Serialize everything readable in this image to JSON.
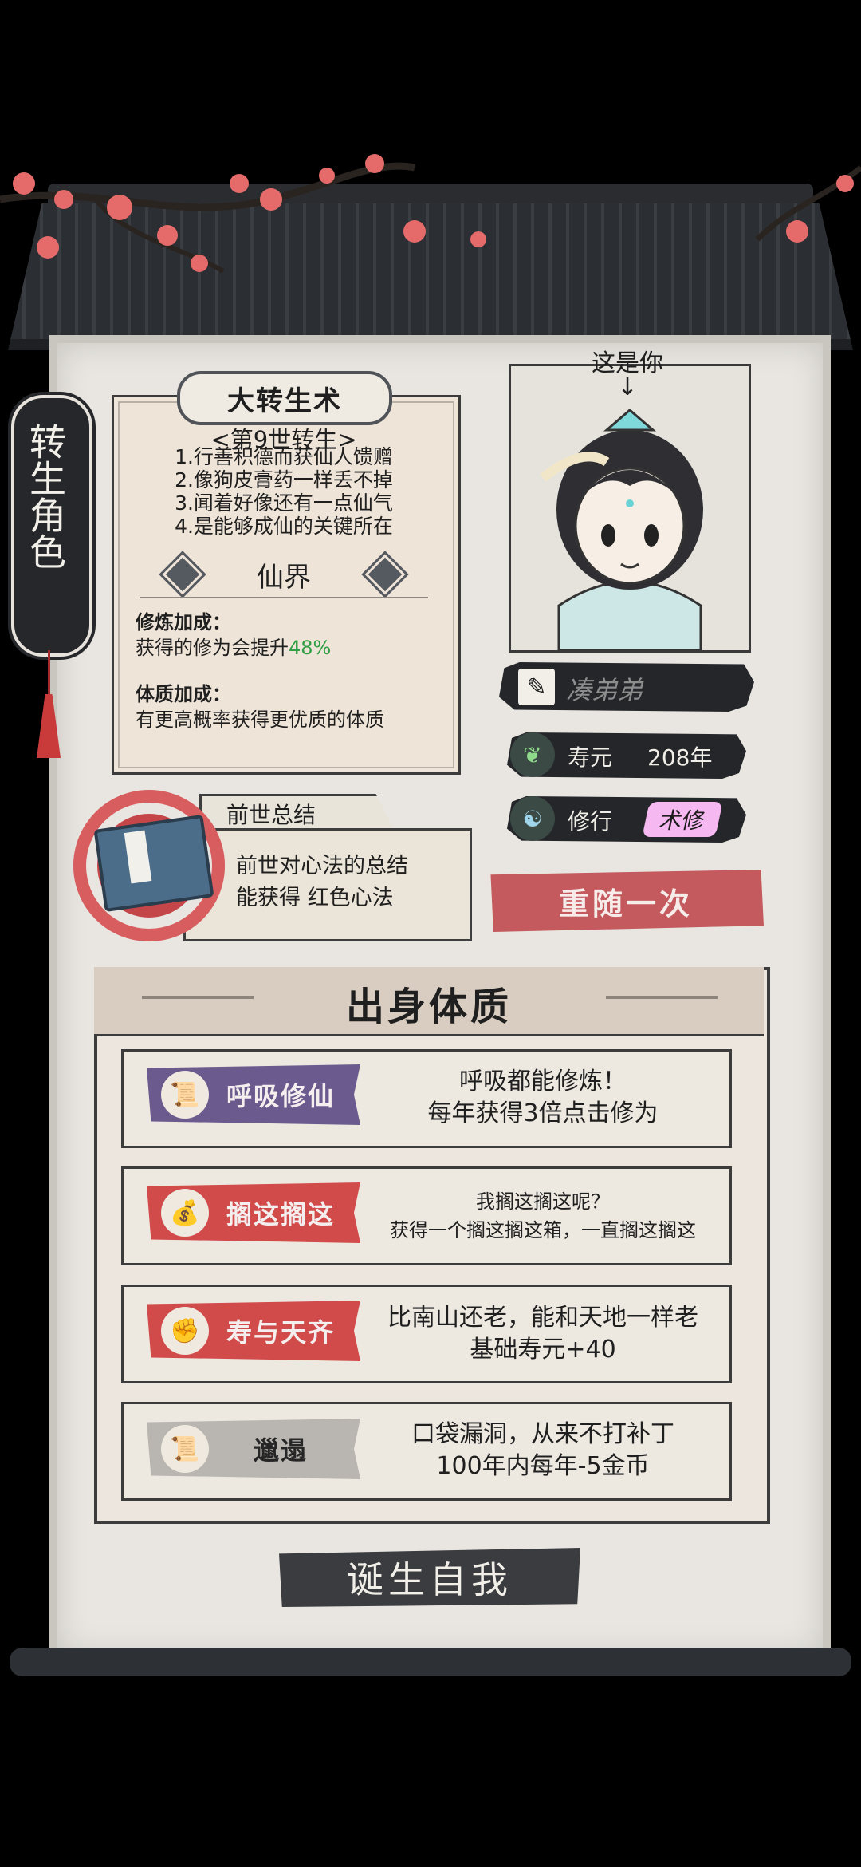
{
  "side_tag": "转生角色",
  "technique": {
    "title": "大转生术",
    "subtitle": "<第9世转生>",
    "lines": [
      "1.行善积德而获仙人馈赠",
      "2.像狗皮膏药一样丢不掉",
      "3.闻着好像还有一点仙气",
      "4.是能够成仙的关键所在"
    ],
    "realm": "仙界",
    "cultivation_bonus_title": "修炼加成：",
    "cultivation_bonus_text": "获得的修为会提升",
    "cultivation_bonus_value": "48%",
    "physique_bonus_title": "体质加成：",
    "physique_bonus_text": "有更高概率获得更优质的体质"
  },
  "portrait": {
    "caption": "这是你",
    "arrow": "↓"
  },
  "player": {
    "name": "凑弟弟",
    "lifespan_label": "寿元",
    "lifespan_value": "208年",
    "practice_label": "修行",
    "practice_value": "术修"
  },
  "past_life": {
    "tab": "前世总结",
    "line1": "前世对心法的总结",
    "line2": "能获得 红色心法"
  },
  "reroll_button": "重随一次",
  "origin": {
    "title": "出身体质",
    "traits": [
      {
        "name": "呼吸修仙",
        "desc1": "呼吸都能修炼！",
        "desc2": "每年获得3倍点击修为",
        "color": "#6b5a8e",
        "icon": "scroll-icon"
      },
      {
        "name": "搁这搁这",
        "desc1": "我搁这搁这呢？",
        "desc2": "获得一个搁这搁这箱，一直搁这搁这",
        "color": "#d24b4b",
        "icon": "bag-icon"
      },
      {
        "name": "寿与天齐",
        "desc1": "比南山还老，能和天地一样老",
        "desc2": "基础寿元+40",
        "color": "#d24b4b",
        "icon": "fist-icon"
      },
      {
        "name": "邋遢",
        "desc1": "口袋漏洞，从来不打补丁",
        "desc2": "100年内每年-5金币",
        "color": "#b9b6b1",
        "icon": "scroll-icon"
      }
    ]
  },
  "birth_button": "诞生自我"
}
